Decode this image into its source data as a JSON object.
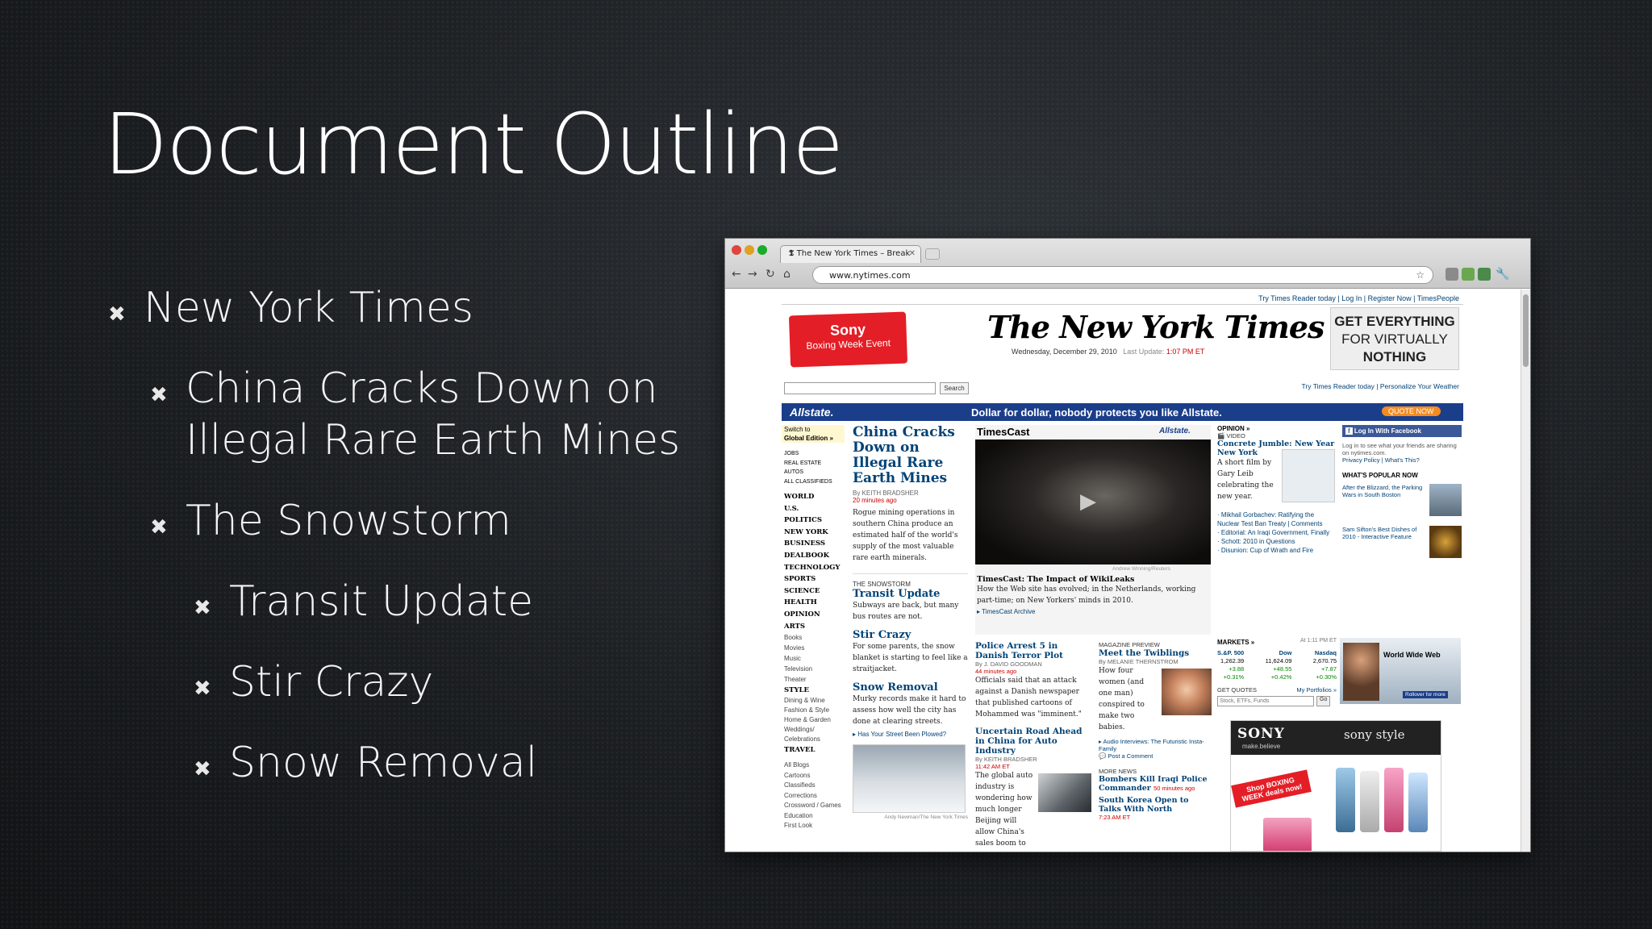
{
  "slide": {
    "title": "Document Outline",
    "bullets": [
      {
        "level": 1,
        "text": "New York Times"
      },
      {
        "level": 2,
        "text": "China Cracks Down on Illegal Rare Earth Mines"
      },
      {
        "level": 2,
        "text": "The Snowstorm"
      },
      {
        "level": 3,
        "text": "Transit Update"
      },
      {
        "level": 3,
        "text": "Stir Crazy"
      },
      {
        "level": 3,
        "text": "Snow Removal"
      }
    ]
  },
  "browser": {
    "tab_title": "The New York Times – Break",
    "url": "www.nytimes.com",
    "colors": {
      "close": "#e0443e",
      "minimize": "#dea123",
      "zoom": "#1aab29"
    }
  },
  "nyt": {
    "top_links": [
      "Try Times Reader today",
      "Log In",
      "Register Now",
      "TimesPeople"
    ],
    "sony_ad": {
      "brand": "Sony",
      "line": "Boxing Week Event"
    },
    "masthead": "The New York Times",
    "date": "Wednesday, December 29, 2010",
    "last_update_label": "Last Update:",
    "last_update_time": "1:07 PM ET",
    "right_ad": [
      "GET EVERYTHING",
      "FOR VIRTUALLY",
      "NOTHING"
    ],
    "search_button": "Search",
    "reader_links": "Try Times Reader today | Personalize Your Weather",
    "banner": {
      "brand": "Allstate.",
      "tagline": "Dollar for dollar, nobody protects you like Allstate.",
      "cta": "QUOTE NOW"
    },
    "edition": [
      "Switch to",
      "Global Edition »"
    ],
    "nav_top": [
      "JOBS",
      "REAL ESTATE",
      "AUTOS",
      "ALL CLASSIFIEDS"
    ],
    "nav_sections": [
      "WORLD",
      "U.S.",
      "POLITICS",
      "NEW YORK",
      "BUSINESS",
      "DEALBOOK",
      "TECHNOLOGY",
      "SPORTS",
      "SCIENCE",
      "HEALTH",
      "OPINION",
      "ARTS"
    ],
    "nav_sub": [
      "Books",
      "Movies",
      "Music",
      "Television",
      "Theater"
    ],
    "nav_style": "STYLE",
    "nav_style_sub": [
      "Dining & Wine",
      "Fashion & Style",
      "Home & Garden",
      "Weddings/ Celebrations"
    ],
    "nav_travel": "TRAVEL",
    "nav_more": [
      "All Blogs",
      "Cartoons",
      "Classifieds",
      "Corrections",
      "Crossword / Games",
      "Education",
      "First Look"
    ],
    "lead": {
      "headline": "China Cracks Down on Illegal Rare Earth Mines",
      "byline": "By KEITH BRADSHER",
      "ago": "20 minutes ago",
      "body": "Rogue mining operations in southern China produce an estimated half of the world's supply of the most valuable rare earth minerals."
    },
    "snowstorm": {
      "kicker": "THE SNOWSTORM",
      "h1": "Transit Update",
      "b1": "Subways are back, but many bus routes are not.",
      "h2": "Stir Crazy",
      "b2": "For some parents, the snow blanket is starting to feel like a straitjacket.",
      "h3": "Snow Removal",
      "b3": "Murky records make it hard to assess how well the city has done at clearing streets.",
      "link": "Has Your Street Been Plowed?",
      "credit": "Andy Newman/The New York Times"
    },
    "timescast": {
      "label": "TimesCast",
      "sponsor": "Allstate.",
      "credit": "Andrew Winning/Reuters",
      "headline": "TimesCast: The Impact of WikiLeaks",
      "body": "How the Web site has evolved; in the Netherlands, working part-time; on New Yorkers' minds in 2010.",
      "archive": "TimesCast Archive"
    },
    "police": {
      "headline": "Police Arrest 5 in Danish Terror Plot",
      "byline": "By J. DAVID GOODMAN",
      "ago": "44 minutes ago",
      "body": "Officials said that an attack against a Danish newspaper that published cartoons of Mohammed was \"imminent.\""
    },
    "road": {
      "headline": "Uncertain Road Ahead in China for Auto Industry",
      "byline": "By KEITH BRADSHER",
      "time": "11:42 AM ET",
      "body": "The global auto industry is wondering how much longer Beijing will allow China's sales boom to go"
    },
    "magazine": {
      "kicker": "MAGAZINE PREVIEW",
      "headline": "Meet the Twiblings",
      "byline": "By MELANIE THERNSTROM",
      "body": "How four women (and one man) conspired to make two babies.",
      "audio": "Audio Interviews: The Futuristic Insta-Family",
      "comment": "Post a Comment"
    },
    "more_news": {
      "kicker": "MORE NEWS",
      "h1": "Bombers Kill Iraqi Police Commander",
      "h1_ago": "50 minutes ago",
      "h2": "South Korea Open to Talks With North",
      "h2_time": "7:23 AM ET"
    },
    "opinion": {
      "kicker": "OPINION »",
      "video": "VIDEO",
      "headline": "Concrete Jumble: New Year New York",
      "body": "A short film by Gary Leib celebrating the new year.",
      "items": [
        "Mikhail Gorbachev: Ratifying the Nuclear Test Ban Treaty",
        "Comments",
        "Editorial: An Iraqi Government, Finally",
        "Schott: 2010 in Questions",
        "Disunion: Cup of Wrath and Fire"
      ]
    },
    "facebook": {
      "button": "Log In With Facebook",
      "text": "Log in to see what your friends are sharing on nytimes.com.",
      "links": "Privacy Policy | What's This?"
    },
    "popular": {
      "title": "WHAT'S POPULAR NOW",
      "items": [
        "After the Blizzard, the Parking Wars in South Boston",
        "Sam Sifton's Best Dishes of 2010 - Interactive Feature"
      ]
    },
    "markets": {
      "title": "MARKETS »",
      "time": "At 1:11 PM ET",
      "cols": [
        {
          "name": "S.&P. 500",
          "value": "1,262.39",
          "change": "+3.88",
          "pct": "+0.31%"
        },
        {
          "name": "Dow",
          "value": "11,624.09",
          "change": "+48.55",
          "pct": "+0.42%"
        },
        {
          "name": "Nasdaq",
          "value": "2,670.75",
          "change": "+7.87",
          "pct": "+0.30%"
        }
      ],
      "quotes_label": "GET QUOTES",
      "portfolios": "My Portfolios »",
      "quotes_placeholder": "Stock, ETFs, Funds",
      "go": "Go"
    },
    "www_ad": {
      "title": "World Wide Web",
      "cta": "Rollover for more"
    },
    "sony_style_ad": {
      "brand": "SONY",
      "sub": "make.believe",
      "style": "sony style",
      "shop": "Shop BOXING WEEK deals now!"
    }
  }
}
